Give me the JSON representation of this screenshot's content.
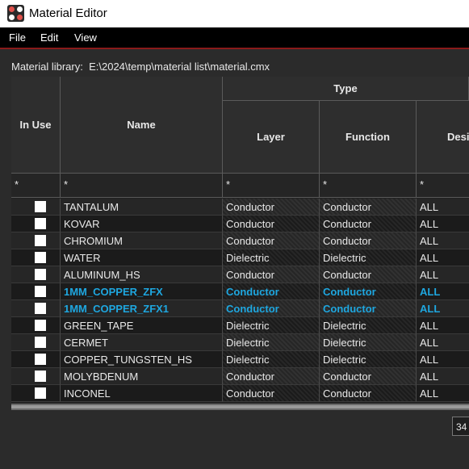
{
  "window": {
    "title": "Material Editor"
  },
  "menu": [
    "File",
    "Edit",
    "View"
  ],
  "library": {
    "label": "Material library:",
    "path": "E:\\2024\\temp\\material list\\material.cmx"
  },
  "columns": {
    "in_use": "In Use",
    "name": "Name",
    "type_group": "Type",
    "layer": "Layer",
    "function": "Function",
    "design": "Desi"
  },
  "filters": {
    "in_use": "*",
    "name": "*",
    "layer": "*",
    "function": "*",
    "design": "*"
  },
  "rows": [
    {
      "name": "TANTALUM",
      "layer": "Conductor",
      "function": "Conductor",
      "design": "ALL",
      "highlight": false
    },
    {
      "name": "KOVAR",
      "layer": "Conductor",
      "function": "Conductor",
      "design": "ALL",
      "highlight": false
    },
    {
      "name": "CHROMIUM",
      "layer": "Conductor",
      "function": "Conductor",
      "design": "ALL",
      "highlight": false
    },
    {
      "name": "WATER",
      "layer": "Dielectric",
      "function": "Dielectric",
      "design": "ALL",
      "highlight": false
    },
    {
      "name": "ALUMINUM_HS",
      "layer": "Conductor",
      "function": "Conductor",
      "design": "ALL",
      "highlight": false
    },
    {
      "name": "1MM_COPPER_ZFX",
      "layer": "Conductor",
      "function": "Conductor",
      "design": "ALL",
      "highlight": true
    },
    {
      "name": "1MM_COPPER_ZFX1",
      "layer": "Conductor",
      "function": "Conductor",
      "design": "ALL",
      "highlight": true
    },
    {
      "name": "GREEN_TAPE",
      "layer": "Dielectric",
      "function": "Dielectric",
      "design": "ALL",
      "highlight": false
    },
    {
      "name": "CERMET",
      "layer": "Dielectric",
      "function": "Dielectric",
      "design": "ALL",
      "highlight": false
    },
    {
      "name": "COPPER_TUNGSTEN_HS",
      "layer": "Dielectric",
      "function": "Dielectric",
      "design": "ALL",
      "highlight": false
    },
    {
      "name": "MOLYBDENUM",
      "layer": "Conductor",
      "function": "Conductor",
      "design": "ALL",
      "highlight": false
    },
    {
      "name": "INCONEL",
      "layer": "Conductor",
      "function": "Conductor",
      "design": "ALL",
      "highlight": false
    }
  ],
  "footer": {
    "count": "34"
  },
  "colors": {
    "highlight": "#1ea7e0",
    "menu_accent": "#8a1a1a"
  }
}
